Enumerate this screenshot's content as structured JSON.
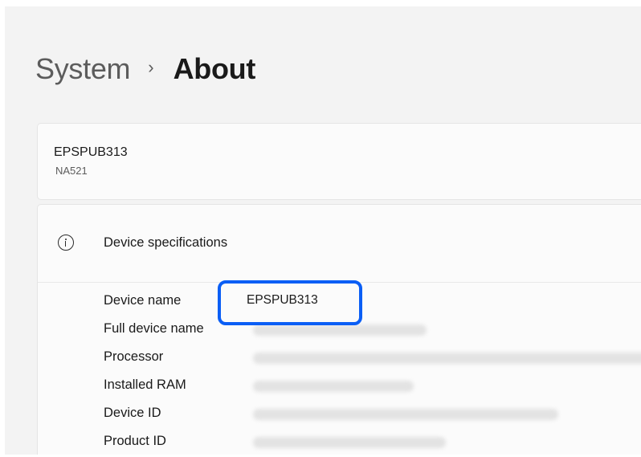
{
  "breadcrumb": {
    "parent": "System",
    "separator": "›",
    "current": "About"
  },
  "device": {
    "name": "EPSPUB313",
    "model": "NA521"
  },
  "specs": {
    "title": "Device specifications",
    "icon": "info-icon",
    "rows": [
      {
        "label": "Device name",
        "value": "EPSPUB313",
        "redacted": false
      },
      {
        "label": "Full device name",
        "value": "",
        "redacted": true
      },
      {
        "label": "Processor",
        "value": "",
        "redacted": true
      },
      {
        "label": "Installed RAM",
        "value": "",
        "redacted": true
      },
      {
        "label": "Device ID",
        "value": "",
        "redacted": true
      },
      {
        "label": "Product ID",
        "value": "",
        "redacted": true
      }
    ]
  },
  "colors": {
    "window_background": "#f3f3f3",
    "card_background": "#fbfbfb",
    "highlight": "#0a5ef5",
    "redaction": "#e3e3e3"
  }
}
